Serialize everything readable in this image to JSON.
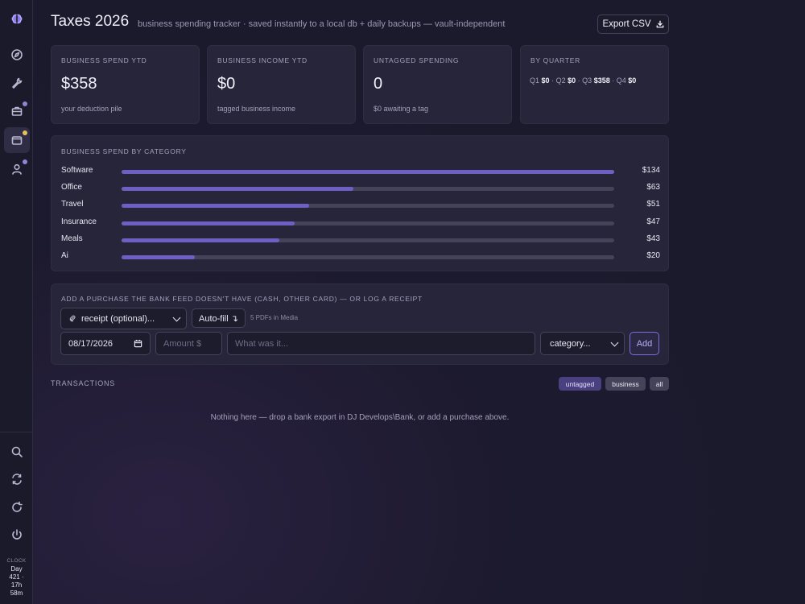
{
  "sidebar": {
    "items": [
      {
        "name": "brain",
        "icon": "brain-logo-icon"
      },
      {
        "name": "compass",
        "icon": "compass-icon"
      },
      {
        "name": "tools",
        "icon": "wrench-icon"
      },
      {
        "name": "briefcase",
        "icon": "briefcase-icon",
        "badge_color": "#8f86d9"
      },
      {
        "name": "wallet",
        "icon": "wallet-icon",
        "active": true,
        "badge_color": "#e6c15a"
      },
      {
        "name": "user",
        "icon": "user-icon",
        "badge_color": "#8f86d9"
      },
      {
        "name": "search",
        "icon": "search-icon"
      },
      {
        "name": "sync",
        "icon": "sync-icon"
      },
      {
        "name": "reload",
        "icon": "reload-icon"
      },
      {
        "name": "power",
        "icon": "power-icon"
      }
    ],
    "clock": {
      "label": "CLOCK",
      "line1": "Day",
      "line2": "421 ·",
      "line3": "17h",
      "line4": "58m"
    }
  },
  "header": {
    "title": "Taxes 2026",
    "subtitle": "business spending tracker · saved instantly to a local db + daily backups — vault-independent",
    "export_label": "Export CSV"
  },
  "stats": [
    {
      "label": "BUSINESS SPEND YTD",
      "value": "$358",
      "sub": "your deduction pile"
    },
    {
      "label": "BUSINESS INCOME YTD",
      "value": "$0",
      "sub": "tagged business income"
    },
    {
      "label": "UNTAGGED SPENDING",
      "value": "0",
      "sub": "$0 awaiting a tag"
    }
  ],
  "quarter_card": {
    "label": "BY QUARTER",
    "q1_label": "Q1",
    "q1": "$0",
    "q2_label": "Q2",
    "q2": "$0",
    "q3_label": "Q3",
    "q3": "$358",
    "q4_label": "Q4",
    "q4": "$0",
    "sep": "·"
  },
  "category_panel": {
    "label": "BUSINESS SPEND BY CATEGORY",
    "max": 134,
    "rows": [
      {
        "name": "Software",
        "amount": "$134",
        "value": 134
      },
      {
        "name": "Office",
        "amount": "$63",
        "value": 63
      },
      {
        "name": "Travel",
        "amount": "$51",
        "value": 51
      },
      {
        "name": "Insurance",
        "amount": "$47",
        "value": 47
      },
      {
        "name": "Meals",
        "amount": "$43",
        "value": 43
      },
      {
        "name": "Ai",
        "amount": "$20",
        "value": 20
      }
    ]
  },
  "add_panel": {
    "label": "ADD A PURCHASE THE BANK FEED DOESN'T HAVE (CASH, OTHER CARD) — OR LOG A RECEIPT",
    "receipt_select": "receipt (optional)...",
    "autofill_label": "Auto-fill ↴",
    "pdf_note": "5 PDFs in Media",
    "date_value": "08/17/2026",
    "amount_placeholder": "Amount $",
    "desc_placeholder": "What was it...",
    "category_select": "category...",
    "add_label": "Add"
  },
  "transactions": {
    "title": "TRANSACTIONS",
    "filters": [
      "untagged",
      "business",
      "all"
    ],
    "active_filter": "untagged",
    "empty_message": "Nothing here — drop a bank export in DJ Develops\\Bank, or add a purchase above."
  },
  "colors": {
    "accent": "#6f5fc4",
    "active_filter": "#4a4080",
    "background": "#1c1a2e",
    "card": "#26253a"
  }
}
